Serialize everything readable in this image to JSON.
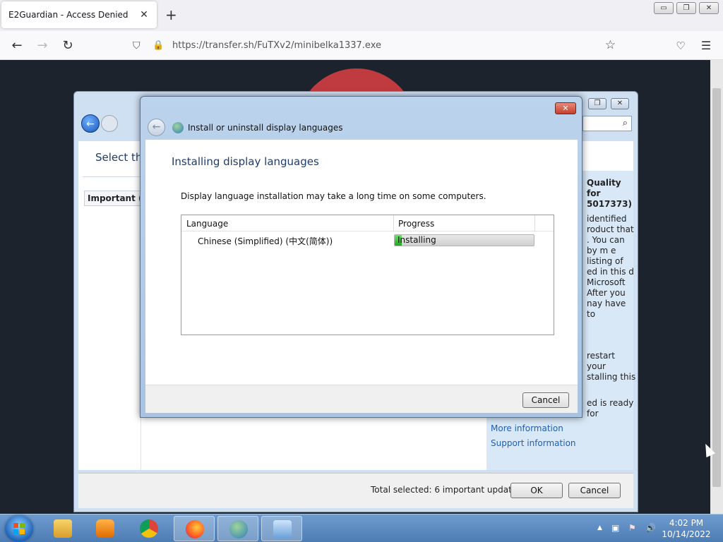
{
  "browser": {
    "tab_title": "E2Guardian - Access Denied",
    "tab_close": "✕",
    "new_tab": "+",
    "url": "https://transfer.sh/FuTXv2/minibelka1337.exe",
    "back_icon": "←",
    "forward_icon": "→",
    "reload_icon": "↻",
    "shield_icon": "⛉",
    "lock_icon": "🔒",
    "star_icon": "☆",
    "pocket_icon": "♡",
    "menu_icon": "☰",
    "win_min": "▭",
    "win_max": "❐",
    "win_close": "✕"
  },
  "update_window": {
    "title_partial": "Select the",
    "important_tab": "Important (6)",
    "details_title": "Quality for 5017373)",
    "details_text_1": "identified roduct that . You can by m e listing of ed in this d Microsoft After you nay have to",
    "details_text_2": "restart your stalling this",
    "details_text_3": "ed is ready for",
    "more_info_link": "More information",
    "support_info_link": "Support information",
    "total_selected": "Total selected: 6 important updates",
    "ok_label": "OK",
    "cancel_label": "Cancel",
    "search_icon": "⌕"
  },
  "dialog": {
    "title": "Install or uninstall display languages",
    "close_label": "✕",
    "back_icon": "←",
    "heading": "Installing display languages",
    "description": "Display language installation may take a long time on some computers.",
    "columns": [
      "Language",
      "Progress"
    ],
    "rows": [
      {
        "language": "Chinese (Simplified) (中文(简体))",
        "status": "Installing",
        "progress": 0.05
      }
    ],
    "cancel_label": "Cancel"
  },
  "taskbar": {
    "time": "4:02 PM",
    "date": "10/14/2022",
    "tray_up_icon": "▲"
  },
  "colors": {
    "accent_blue": "#1e3c6e",
    "progress_green": "#1fa81f",
    "link_blue": "#1d5fb8",
    "taskbar_blue": "#4d7cb4"
  }
}
